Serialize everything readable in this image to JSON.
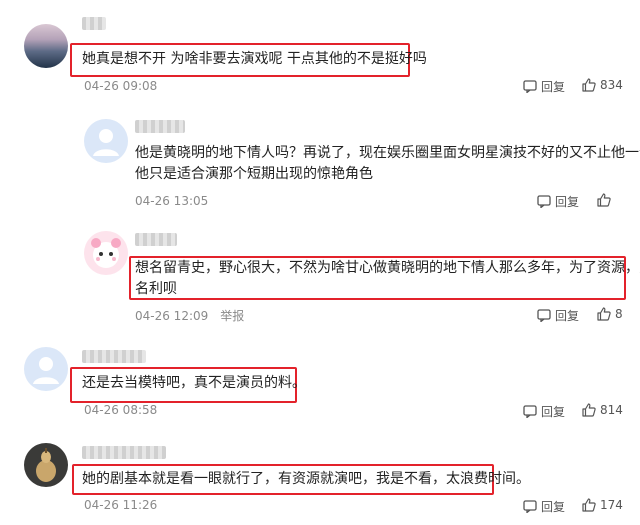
{
  "comments": [
    {
      "text_lines": [
        "她真是想不开 为啥非要去演戏呢 干点其他的不是挺好吗"
      ],
      "time": "04-26 09:08",
      "reply_label": "回复",
      "likes": "834"
    },
    {
      "text_lines": [
        "他是黄晓明的地下情人吗？再说了，现在娱乐圈里面女明星演技不好的又不止他一个。",
        "他只是适合演那个短期出现的惊艳角色"
      ],
      "time": "04-26 13:05",
      "reply_label": "回复",
      "likes": ""
    },
    {
      "text_lines": [
        "想名留青史，野心很大，不然为啥甘心做黄晓明的地下情人那么多年，为了资源，为了",
        "名利呗"
      ],
      "time": "04-26 12:09",
      "report_label": "举报",
      "reply_label": "回复",
      "likes": "8"
    },
    {
      "text_lines": [
        "还是去当模特吧，真不是演员的料。"
      ],
      "time": "04-26 08:58",
      "reply_label": "回复",
      "likes": "814"
    },
    {
      "text_lines": [
        "她的剧基本就是看一眼就行了，有资源就演吧，我是不看，太浪费时间。"
      ],
      "time": "04-26 11:26",
      "reply_label": "回复",
      "likes": "174"
    }
  ],
  "colors": {
    "highlight_border": "#e3222b",
    "meta_text": "#8a8a8a",
    "body_text": "#222222"
  },
  "icons": [
    "reply-icon",
    "thumbs-up-icon"
  ]
}
